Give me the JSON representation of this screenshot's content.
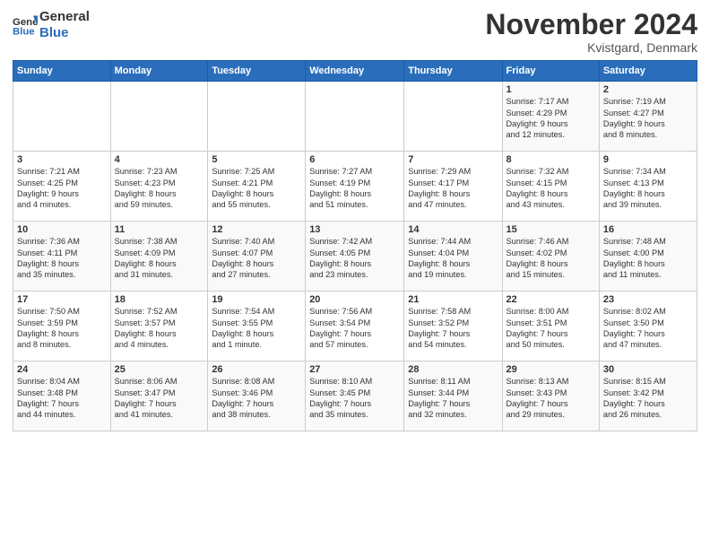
{
  "header": {
    "logo_general": "General",
    "logo_blue": "Blue",
    "month_title": "November 2024",
    "location": "Kvistgard, Denmark"
  },
  "days_of_week": [
    "Sunday",
    "Monday",
    "Tuesday",
    "Wednesday",
    "Thursday",
    "Friday",
    "Saturday"
  ],
  "weeks": [
    [
      {
        "day": "",
        "info": ""
      },
      {
        "day": "",
        "info": ""
      },
      {
        "day": "",
        "info": ""
      },
      {
        "day": "",
        "info": ""
      },
      {
        "day": "",
        "info": ""
      },
      {
        "day": "1",
        "info": "Sunrise: 7:17 AM\nSunset: 4:29 PM\nDaylight: 9 hours\nand 12 minutes."
      },
      {
        "day": "2",
        "info": "Sunrise: 7:19 AM\nSunset: 4:27 PM\nDaylight: 9 hours\nand 8 minutes."
      }
    ],
    [
      {
        "day": "3",
        "info": "Sunrise: 7:21 AM\nSunset: 4:25 PM\nDaylight: 9 hours\nand 4 minutes."
      },
      {
        "day": "4",
        "info": "Sunrise: 7:23 AM\nSunset: 4:23 PM\nDaylight: 8 hours\nand 59 minutes."
      },
      {
        "day": "5",
        "info": "Sunrise: 7:25 AM\nSunset: 4:21 PM\nDaylight: 8 hours\nand 55 minutes."
      },
      {
        "day": "6",
        "info": "Sunrise: 7:27 AM\nSunset: 4:19 PM\nDaylight: 8 hours\nand 51 minutes."
      },
      {
        "day": "7",
        "info": "Sunrise: 7:29 AM\nSunset: 4:17 PM\nDaylight: 8 hours\nand 47 minutes."
      },
      {
        "day": "8",
        "info": "Sunrise: 7:32 AM\nSunset: 4:15 PM\nDaylight: 8 hours\nand 43 minutes."
      },
      {
        "day": "9",
        "info": "Sunrise: 7:34 AM\nSunset: 4:13 PM\nDaylight: 8 hours\nand 39 minutes."
      }
    ],
    [
      {
        "day": "10",
        "info": "Sunrise: 7:36 AM\nSunset: 4:11 PM\nDaylight: 8 hours\nand 35 minutes."
      },
      {
        "day": "11",
        "info": "Sunrise: 7:38 AM\nSunset: 4:09 PM\nDaylight: 8 hours\nand 31 minutes."
      },
      {
        "day": "12",
        "info": "Sunrise: 7:40 AM\nSunset: 4:07 PM\nDaylight: 8 hours\nand 27 minutes."
      },
      {
        "day": "13",
        "info": "Sunrise: 7:42 AM\nSunset: 4:05 PM\nDaylight: 8 hours\nand 23 minutes."
      },
      {
        "day": "14",
        "info": "Sunrise: 7:44 AM\nSunset: 4:04 PM\nDaylight: 8 hours\nand 19 minutes."
      },
      {
        "day": "15",
        "info": "Sunrise: 7:46 AM\nSunset: 4:02 PM\nDaylight: 8 hours\nand 15 minutes."
      },
      {
        "day": "16",
        "info": "Sunrise: 7:48 AM\nSunset: 4:00 PM\nDaylight: 8 hours\nand 11 minutes."
      }
    ],
    [
      {
        "day": "17",
        "info": "Sunrise: 7:50 AM\nSunset: 3:59 PM\nDaylight: 8 hours\nand 8 minutes."
      },
      {
        "day": "18",
        "info": "Sunrise: 7:52 AM\nSunset: 3:57 PM\nDaylight: 8 hours\nand 4 minutes."
      },
      {
        "day": "19",
        "info": "Sunrise: 7:54 AM\nSunset: 3:55 PM\nDaylight: 8 hours\nand 1 minute."
      },
      {
        "day": "20",
        "info": "Sunrise: 7:56 AM\nSunset: 3:54 PM\nDaylight: 7 hours\nand 57 minutes."
      },
      {
        "day": "21",
        "info": "Sunrise: 7:58 AM\nSunset: 3:52 PM\nDaylight: 7 hours\nand 54 minutes."
      },
      {
        "day": "22",
        "info": "Sunrise: 8:00 AM\nSunset: 3:51 PM\nDaylight: 7 hours\nand 50 minutes."
      },
      {
        "day": "23",
        "info": "Sunrise: 8:02 AM\nSunset: 3:50 PM\nDaylight: 7 hours\nand 47 minutes."
      }
    ],
    [
      {
        "day": "24",
        "info": "Sunrise: 8:04 AM\nSunset: 3:48 PM\nDaylight: 7 hours\nand 44 minutes."
      },
      {
        "day": "25",
        "info": "Sunrise: 8:06 AM\nSunset: 3:47 PM\nDaylight: 7 hours\nand 41 minutes."
      },
      {
        "day": "26",
        "info": "Sunrise: 8:08 AM\nSunset: 3:46 PM\nDaylight: 7 hours\nand 38 minutes."
      },
      {
        "day": "27",
        "info": "Sunrise: 8:10 AM\nSunset: 3:45 PM\nDaylight: 7 hours\nand 35 minutes."
      },
      {
        "day": "28",
        "info": "Sunrise: 8:11 AM\nSunset: 3:44 PM\nDaylight: 7 hours\nand 32 minutes."
      },
      {
        "day": "29",
        "info": "Sunrise: 8:13 AM\nSunset: 3:43 PM\nDaylight: 7 hours\nand 29 minutes."
      },
      {
        "day": "30",
        "info": "Sunrise: 8:15 AM\nSunset: 3:42 PM\nDaylight: 7 hours\nand 26 minutes."
      }
    ]
  ]
}
